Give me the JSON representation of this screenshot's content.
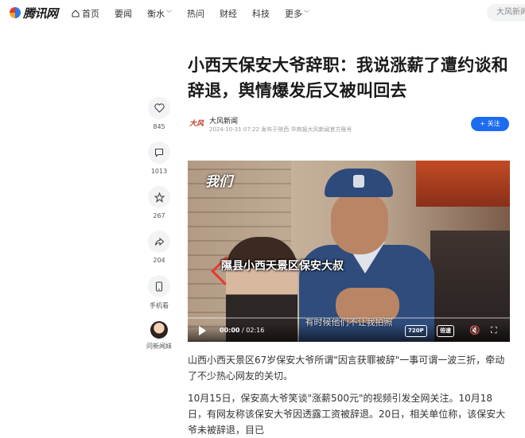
{
  "nav": {
    "logo": "腾讯网",
    "items": [
      {
        "label": "首页",
        "icon": "home-icon"
      },
      {
        "label": "要闻"
      },
      {
        "label": "衡水",
        "dropdown": true
      },
      {
        "label": "热问"
      },
      {
        "label": "财经"
      },
      {
        "label": "科技"
      },
      {
        "label": "更多",
        "dropdown": true
      }
    ],
    "search_placeholder": "大风新闻"
  },
  "rail": {
    "like_count": "845",
    "comment_count": "1013",
    "favorite_count": "267",
    "share_count": "204",
    "mobile_label": "手机看",
    "ai_label": "问新闻妹"
  },
  "article": {
    "title": "小西天保安大爷辞职：我说涨薪了遭约谈和辞退，舆情爆发后又被叫回去",
    "author": "大风新闻",
    "meta": "2024-10-31 07:22  发布于陕西  华商报大风新闻官方账号",
    "follow_label": "+ 关注",
    "paragraphs": [
      "山西小西天景区67岁保安大爷所谓\"因言获罪被辞\"一事可谓一波三折，牵动了不少热心网友的关切。",
      "10月15日，保安高大爷笑谈\"涨薪500元\"的视频引发全网关注。10月18日，有网友称该保安大爷因透露工资被辞退。20日，相关单位称，该保安大爷未被辞退，目已"
    ]
  },
  "video": {
    "watermark": "我们",
    "caption": "隰县小西天景区保安大叔",
    "subtitle": "有时候他们不让我拍照",
    "time_current": "00:00",
    "time_total": "02:16",
    "quality_label": "720P",
    "speed_label": "倍速"
  },
  "colors": {
    "accent": "#1c6cf0",
    "caption_red": "#e63b2e"
  }
}
